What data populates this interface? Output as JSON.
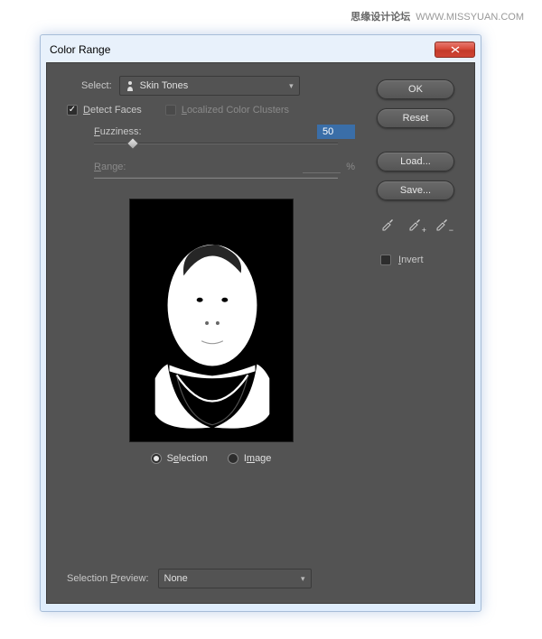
{
  "watermark": {
    "cn": "思缘设计论坛",
    "url": "WWW.MISSYUAN.COM"
  },
  "title": "Color Range",
  "select": {
    "label": "Select:",
    "value": "Skin Tones"
  },
  "detect_faces": {
    "label": "Detect Faces",
    "checked": true
  },
  "localized": {
    "label": "Localized Color Clusters",
    "enabled": false
  },
  "fuzziness": {
    "label": "Fuzziness:",
    "value": "50",
    "pos_pct": 16
  },
  "range": {
    "label": "Range:",
    "unit": "%"
  },
  "previewMode": {
    "selection": "Selection",
    "image": "Image",
    "value": "selection"
  },
  "selection_preview": {
    "label": "Selection Preview:",
    "value": "None"
  },
  "buttons": {
    "ok": "OK",
    "reset": "Reset",
    "load": "Load...",
    "save": "Save..."
  },
  "invert": {
    "label": "Invert",
    "checked": false
  },
  "eyedroppers": [
    "eyedropper",
    "eyedropper-plus",
    "eyedropper-minus"
  ]
}
